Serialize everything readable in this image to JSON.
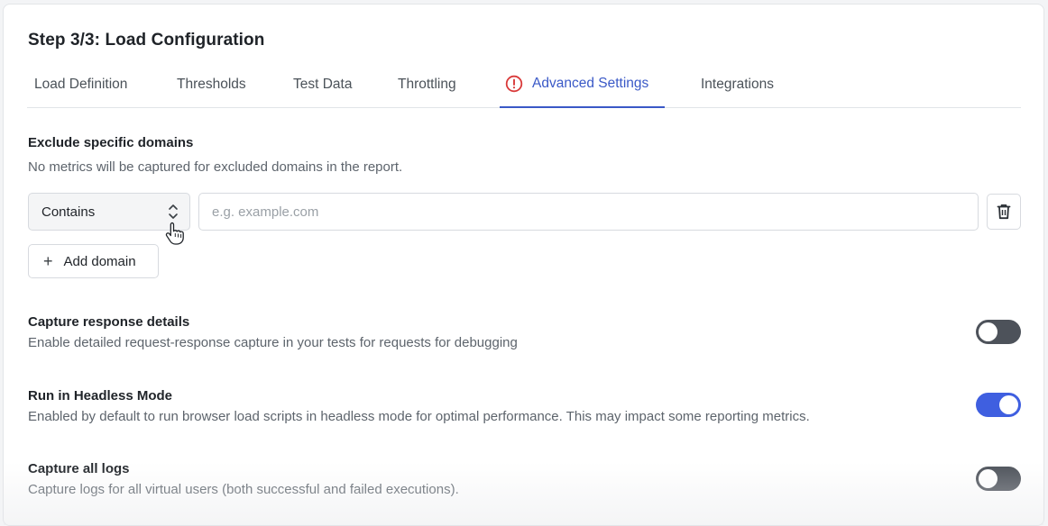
{
  "header": {
    "title": "Step 3/3: Load Configuration"
  },
  "tabs": [
    {
      "label": "Load Definition",
      "active": false
    },
    {
      "label": "Thresholds",
      "active": false
    },
    {
      "label": "Test Data",
      "active": false
    },
    {
      "label": "Throttling",
      "active": false
    },
    {
      "label": "Advanced Settings",
      "active": true,
      "icon": "alert-circle-icon"
    },
    {
      "label": "Integrations",
      "active": false
    }
  ],
  "exclude_domains": {
    "title": "Exclude specific domains",
    "description": "No metrics will be captured for excluded domains in the report.",
    "match_select": {
      "value": "Contains"
    },
    "domain_input": {
      "value": "",
      "placeholder": "e.g. example.com"
    },
    "delete_icon": "trash-icon",
    "add_button_label": "Add domain"
  },
  "settings": [
    {
      "title": "Capture response details",
      "description": "Enable detailed request-response capture in your tests for requests for debugging",
      "enabled": false
    },
    {
      "title": "Run in Headless Mode",
      "description": "Enabled by default to run browser load scripts in headless mode for optimal performance. This may impact some reporting metrics.",
      "enabled": true
    },
    {
      "title": "Capture all logs",
      "description": "Capture logs for all virtual users (both successful and failed executions).",
      "enabled": false
    }
  ],
  "colors": {
    "accent": "#3a59c7",
    "toggle_on": "#3f5fe0",
    "toggle_off": "#4d525a",
    "alert": "#d93a3a"
  }
}
